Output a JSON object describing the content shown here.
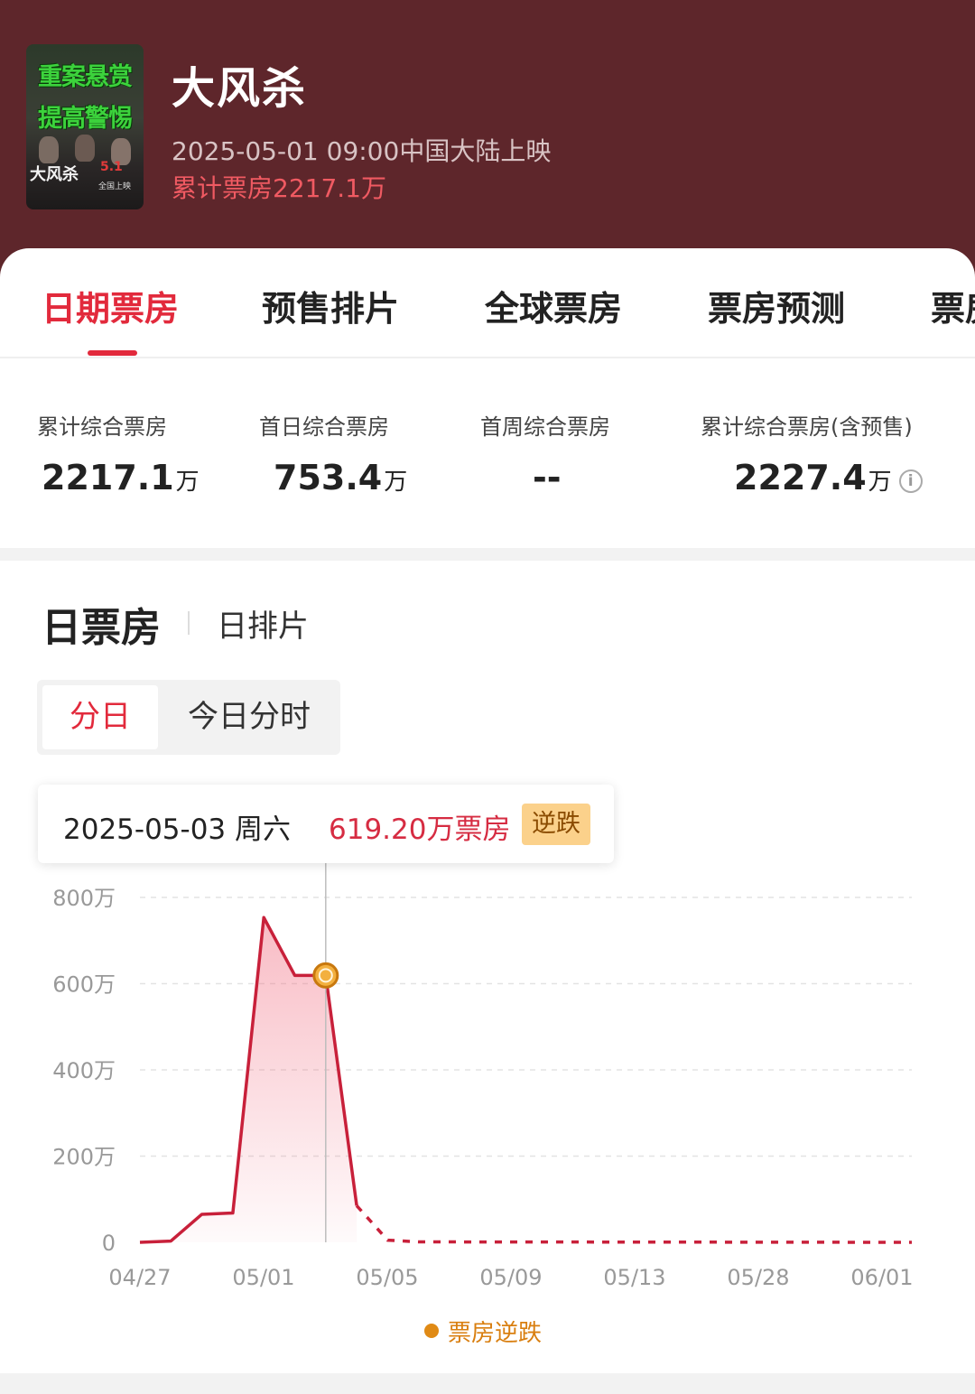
{
  "movie": {
    "poster_title": "大风杀",
    "poster_lines": [
      "重案悬赏",
      "提高警惕"
    ],
    "poster_date": "5.1",
    "poster_sub": "全国上映",
    "title": "大风杀",
    "release": "2025-05-01 09:00中国大陆上映",
    "total_box_office": "累计票房2217.1万"
  },
  "tabs": [
    {
      "label": "日期票房",
      "active": true
    },
    {
      "label": "预售排片",
      "active": false
    },
    {
      "label": "全球票房",
      "active": false
    },
    {
      "label": "票房预测",
      "active": false
    },
    {
      "label": "票房",
      "active": false
    }
  ],
  "stats": [
    {
      "label": "累计综合票房",
      "value": "2217.1",
      "unit": "万"
    },
    {
      "label": "首日综合票房",
      "value": "753.4",
      "unit": "万"
    },
    {
      "label": "首周综合票房",
      "value": "--",
      "unit": ""
    },
    {
      "label": "累计综合票房(含预售)",
      "value": "2227.4",
      "unit": "万"
    }
  ],
  "section": {
    "title": "日票房",
    "subtitle": "日排片"
  },
  "segment": {
    "options": [
      "分日",
      "今日分时"
    ],
    "selected": "分日"
  },
  "tooltip": {
    "date": "2025-05-03 周六",
    "value": "619.20万票房",
    "badge": "逆跌"
  },
  "legend": {
    "label": "票房逆跌",
    "color": "#e08a15"
  },
  "colors": {
    "header_bg": "#5e262b",
    "accent": "#e22a3c",
    "line": "#c8203a",
    "badge_bg": "#fbd18b"
  },
  "chart_data": {
    "type": "area",
    "title": "",
    "xlabel": "",
    "ylabel": "",
    "ylim": [
      0,
      800
    ],
    "yticks": [
      "0",
      "200万",
      "400万",
      "600万",
      "800万"
    ],
    "ytick_values": [
      0,
      200,
      400,
      600,
      800
    ],
    "xtick_labels": [
      "04/27",
      "05/01",
      "05/05",
      "05/09",
      "05/13",
      "05/28",
      "06/01"
    ],
    "series": [
      {
        "points": [
          {
            "x": 0,
            "y": 0
          },
          {
            "x": 1,
            "y": 3
          },
          {
            "x": 2,
            "y": 65
          },
          {
            "x": 3,
            "y": 68
          },
          {
            "x": 4,
            "y": 753.4
          },
          {
            "x": 5,
            "y": 619.2
          },
          {
            "x": 6,
            "y": 619.2
          },
          {
            "x": 7,
            "y": 85
          }
        ],
        "projected": [
          {
            "x": 7,
            "y": 85
          },
          {
            "x": 8,
            "y": 5
          },
          {
            "x": 9,
            "y": 1
          },
          {
            "x": 25,
            "y": 0
          }
        ],
        "highlight": {
          "x": 6,
          "y": 619.2
        }
      }
    ],
    "grid": true,
    "legend_position": "bottom-center"
  }
}
